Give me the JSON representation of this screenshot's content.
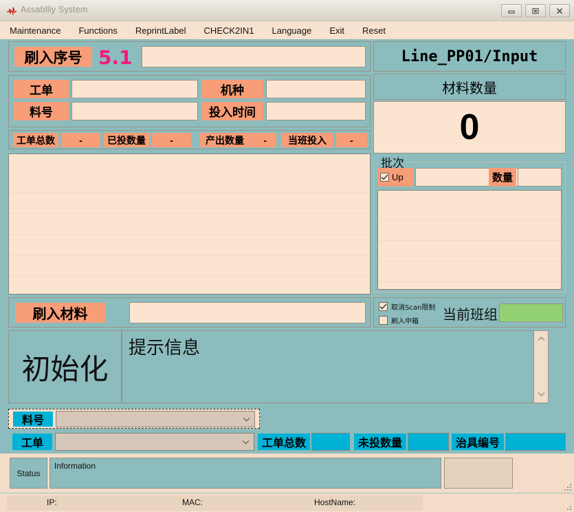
{
  "window": {
    "title": "Assabllly System",
    "logo_icon": "red-logo-icon",
    "minimize_label": "minimize",
    "maximize_label": "maximize",
    "close_label": "close"
  },
  "menu": {
    "items": [
      {
        "label": "Maintenance"
      },
      {
        "label": "Functions"
      },
      {
        "label": "ReprintLabel"
      },
      {
        "label": "CHECK2IN1"
      },
      {
        "label": "Language"
      },
      {
        "label": "Exit"
      },
      {
        "label": "Reset"
      }
    ]
  },
  "serial": {
    "label": "刷入序号",
    "version": "5.1",
    "value": "",
    "placeholder": ""
  },
  "workorder": {
    "wo_label": "工单",
    "wo_value": "",
    "model_label": "机种",
    "model_value": "",
    "part_label": "料号",
    "part_value": "",
    "time_label": "投入时间",
    "time_value": ""
  },
  "counters": [
    {
      "label": "工单总数",
      "value": "-"
    },
    {
      "label": "已投数量",
      "value": "-"
    },
    {
      "label": "产出数量",
      "value": "-"
    },
    {
      "label": "当班投入",
      "value": "-"
    }
  ],
  "main_list": {
    "rows": [
      "",
      "",
      "",
      "",
      "",
      ""
    ]
  },
  "material": {
    "label": "刷入材料",
    "value": "",
    "placeholder": ""
  },
  "state": {
    "status_text": "初始化",
    "message_title": "提示信息",
    "message_body": "",
    "scroll_up_icon": "chevron-up-icon",
    "scroll_down_icon": "chevron-down-icon"
  },
  "right": {
    "line_name": "Line_PP01/Input",
    "qty_title": "材料数量",
    "qty_value": "0",
    "batch_legend": "批次",
    "batch_up_label": "Up",
    "batch_up_checked": true,
    "batch_value": "",
    "batch_qty_label": "数量",
    "batch_qty_value": "",
    "batch_rows": [
      "",
      "",
      "",
      "",
      ""
    ]
  },
  "options": {
    "cancel_scan_label": "取消Scan限制",
    "cancel_scan_checked": true,
    "box_scan_label": "刷入中箱",
    "box_scan_checked": false,
    "shift_label": "当前班组",
    "shift_value": ""
  },
  "bottom_form": {
    "part_label": "料号",
    "part_value": "",
    "wo_label": "工单",
    "wo_value": "",
    "total_label": "工单总数",
    "total_value": "",
    "remain_label": "未投数量",
    "remain_value": "",
    "fixture_label": "治具编号",
    "fixture_value": "",
    "dropdown_icon": "chevron-down-icon"
  },
  "statusbar": {
    "status_label": "Status",
    "information_label": "Information",
    "information_value": "",
    "ip_label": "IP:",
    "ip_value": "",
    "mac_label": "MAC:",
    "mac_value": "",
    "hostname_label": "HostName:",
    "hostname_value": ""
  },
  "colors": {
    "app_bg": "#8cbcbd",
    "field_bg": "#fce5d0",
    "tag_orange": "#f79d77",
    "tag_cyan": "#00b2d6",
    "version_pink": "#f5197f",
    "shift_green": "#92d272",
    "menu_bg": "#f7e2cf"
  }
}
